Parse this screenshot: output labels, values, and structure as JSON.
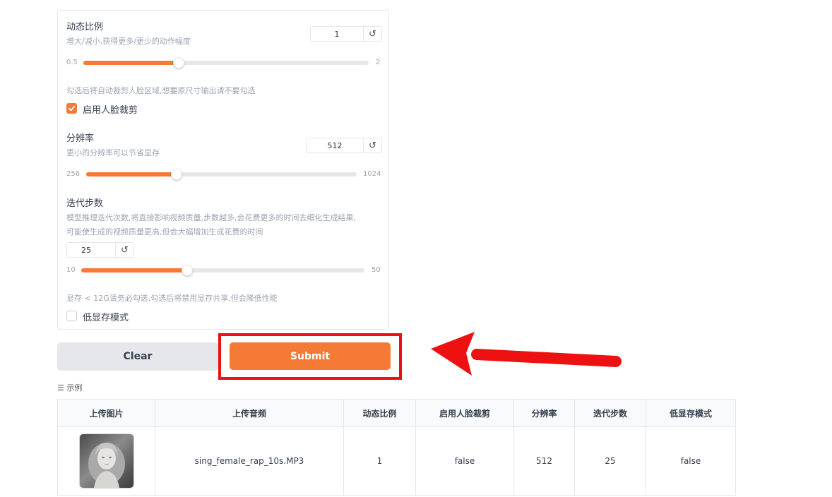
{
  "settings": {
    "motion_scale": {
      "label": "动态比例",
      "hint": "增大/减小,获得更多/更少的动作幅度",
      "value": "1",
      "min": "0.5",
      "max": "2",
      "fraction": 0.333
    },
    "face_crop": {
      "hint": "勾选后将自动裁剪人脸区域,想要原尺寸输出请不要勾选",
      "label": "启用人脸裁剪",
      "checked": true
    },
    "resolution": {
      "label": "分辨率",
      "hint": "更小的分辨率可以节省显存",
      "value": "512",
      "min": "256",
      "max": "1024",
      "fraction": 0.333
    },
    "steps": {
      "label": "迭代步数",
      "hint1": "模型推理迭代次数,将直接影响视频质量,步数越多,会花费更多的时间去细化生成结果,",
      "hint2": "可能使生成的视频质量更高,但会大幅增加生成花费的时间",
      "value": "25",
      "min": "10",
      "max": "50",
      "fraction": 0.375
    },
    "low_vram": {
      "hint": "显存 < 12G请务必勾选,勾选后将禁用显存共享,但会降低性能",
      "label": "低显存模式",
      "checked": false
    }
  },
  "buttons": {
    "clear": "Clear",
    "submit": "Submit"
  },
  "examples": {
    "title": "示例",
    "headers": [
      "上传图片",
      "上传音频",
      "动态比例",
      "启用人脸裁剪",
      "分辨率",
      "迭代步数",
      "低显存模式"
    ],
    "rows": [
      {
        "audio": "sing_female_rap_10s.MP3",
        "motion_scale": "1",
        "face_crop": "false",
        "resolution": "512",
        "steps": "25",
        "low_vram": "false"
      }
    ]
  },
  "colors": {
    "accent": "#f47a36",
    "annotation": "#ee1111"
  },
  "icons": {
    "reset": "↺",
    "check": "✓",
    "list": "☰"
  }
}
